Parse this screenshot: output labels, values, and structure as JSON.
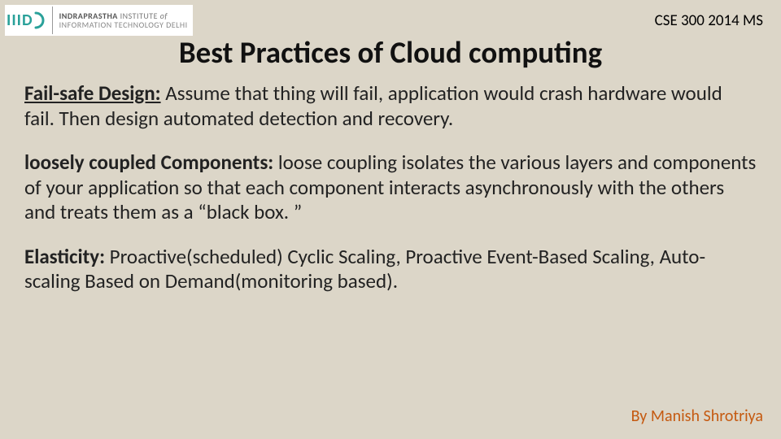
{
  "logo": {
    "mark_prefix": "III",
    "mark_letter": "D",
    "line1_a": "INDRAPRASTHA",
    "line1_b": " INSTITUTE ",
    "line1_c": "of",
    "line2": "INFORMATION TECHNOLOGY DELHI"
  },
  "course_code": "CSE 300 2014 MS",
  "title": "Best Practices of Cloud computing",
  "sections": [
    {
      "heading": "Fail-safe Design:",
      "text": " Assume that thing will fail, application would crash hardware would fail. Then design automated detection and recovery."
    },
    {
      "heading": "loosely coupled Components:",
      "text": " loose coupling isolates the various layers and components of your application so that each component interacts asynchronously with the others and treats them as a “black box. ”"
    },
    {
      "heading": "Elasticity:",
      "text": " Proactive(scheduled) Cyclic Scaling, Proactive Event-Based Scaling, Auto-scaling Based on Demand(monitoring based)."
    }
  ],
  "author": "By Manish Shrotriya"
}
